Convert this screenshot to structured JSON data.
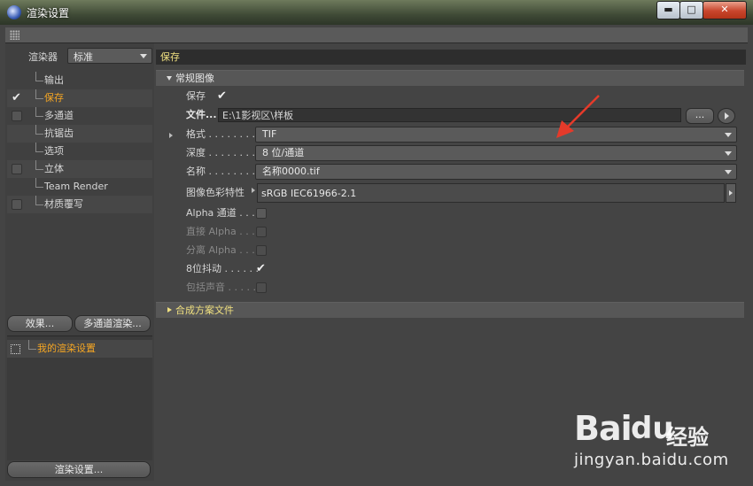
{
  "window": {
    "title": "渲染设置",
    "min": "▬",
    "max": "□",
    "close": "✕"
  },
  "left": {
    "renderer_label": "渲染器",
    "renderer_value": "标准",
    "tree": [
      {
        "label": "输出",
        "check": "none"
      },
      {
        "label": "保存",
        "check": "tick",
        "selected": true
      },
      {
        "label": "多通道",
        "check": "box"
      },
      {
        "label": "抗锯齿",
        "check": "none"
      },
      {
        "label": "选项",
        "check": "none"
      },
      {
        "label": "立体",
        "check": "box"
      },
      {
        "label": "Team Render",
        "check": "none"
      },
      {
        "label": "材质覆写",
        "check": "box"
      }
    ],
    "effects_button": "效果...",
    "multipass_button": "多通道渲染...",
    "preset": "我的渲染设置",
    "render_settings_button": "渲染设置..."
  },
  "main": {
    "header": "保存",
    "general_section": "常规图像",
    "save_label": "保存",
    "file_label": "文件...",
    "file_value": "E:\\1影视区\\样板",
    "file_dots": "...",
    "format_label": "格式 . . . . . . . . .",
    "format_value": "TIF",
    "depth_label": "深度 . . . . . . . . .",
    "depth_value": "8 位/通道",
    "name_label": "名称 . . . . . . . . .",
    "name_value": "名称0000.tif",
    "colorprofile_label": "图像色彩特性",
    "colorprofile_value": "sRGB IEC61966-2.1",
    "alpha_label": "Alpha 通道 . . .",
    "straight_alpha_label": "直接 Alpha . . .",
    "separate_alpha_label": "分离 Alpha . . .",
    "dither_label": "8位抖动 . . . . . .",
    "include_sound_label": "包括声音 . . . . .",
    "compositing_section": "合成方案文件"
  },
  "watermark": {
    "logo": "Bai",
    "du": "du",
    "jingyan": "经验",
    "url": "jingyan.baidu.com"
  },
  "colors": {
    "accent": "#f5a623",
    "header_text": "#f0e080",
    "arrow": "#e53a2a"
  }
}
